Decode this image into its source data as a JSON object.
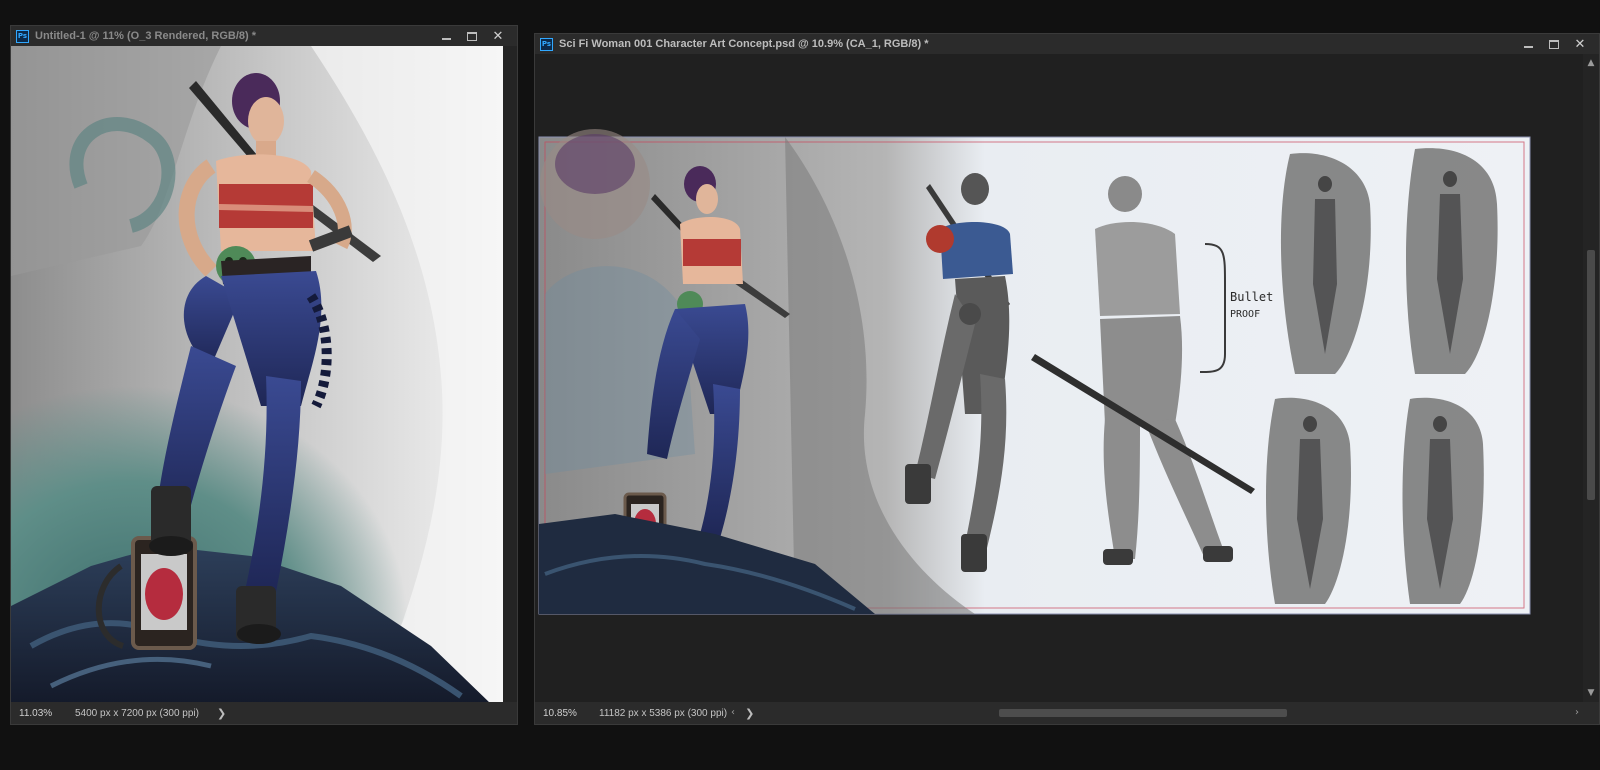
{
  "app": {
    "icon_label": "Ps",
    "icon": "photoshop-icon"
  },
  "window_left": {
    "title": "Untitled-1 @ 11% (O_3 Rendered, RGB/8) *",
    "zoom": "11.03%",
    "doc_info": "5400 px x 7200 px (300 ppi)",
    "status_arrow": "❯"
  },
  "window_right": {
    "title": "Sci Fi Woman 001 Character Art Concept.psd @ 10.9% (CA_1, RGB/8) *",
    "zoom": "10.85%",
    "doc_info": "11182 px x 5386 px (300 ppi)",
    "status_arrow": "❯",
    "annotation": [
      "Bullet",
      "PROOF"
    ]
  },
  "controls": {
    "minimize": "minimize-icon",
    "maximize": "maximize-icon",
    "close": "✕"
  },
  "scroll": {
    "up": "▲",
    "down": "▼",
    "left": "‹",
    "right": "›"
  },
  "colors": {
    "app_bg": "#111111",
    "panel_bg": "#262626",
    "accent_ps": "#31a8ff",
    "figure_pants": "#2c3a78",
    "figure_top": "#b53a36",
    "skull_green": "#4f8a58",
    "smoke_teal": "#5f8e88",
    "hair_purple": "#4a2a5a"
  }
}
